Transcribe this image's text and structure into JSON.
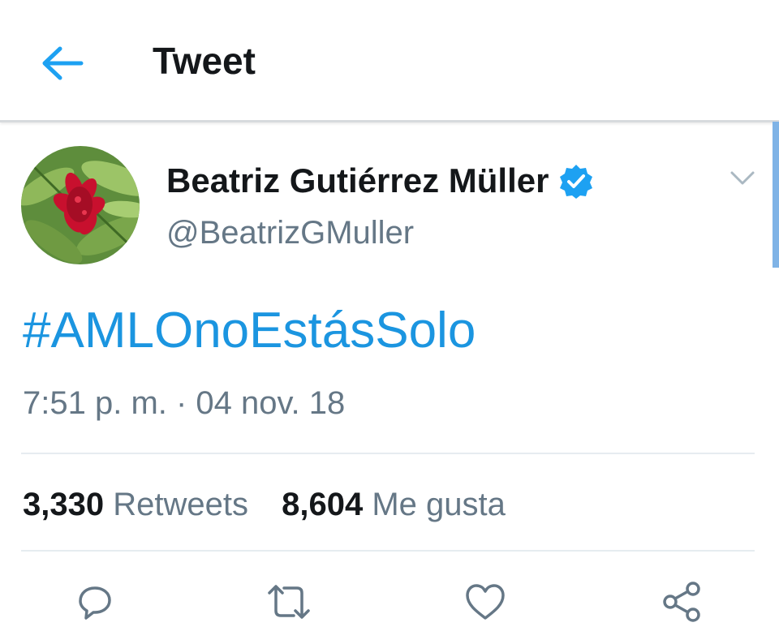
{
  "header": {
    "title": "Tweet",
    "back_icon": "arrow-left-icon",
    "accent": "#1da1f2"
  },
  "tweet": {
    "display_name": "Beatriz Gutiérrez Müller",
    "verified_icon": "verified-badge-icon",
    "handle": "@BeatrizGMuller",
    "text": "#AMLOnoEstásSolo",
    "timestamp": "7:51 p. m. · 04 nov. 18",
    "link_color": "#1b95e0"
  },
  "stats": {
    "retweets_count": "3,330",
    "retweets_label": "Retweets",
    "likes_count": "8,604",
    "likes_label": "Me gusta"
  },
  "actions": [
    "reply-icon",
    "retweet-icon",
    "like-icon",
    "share-icon"
  ]
}
